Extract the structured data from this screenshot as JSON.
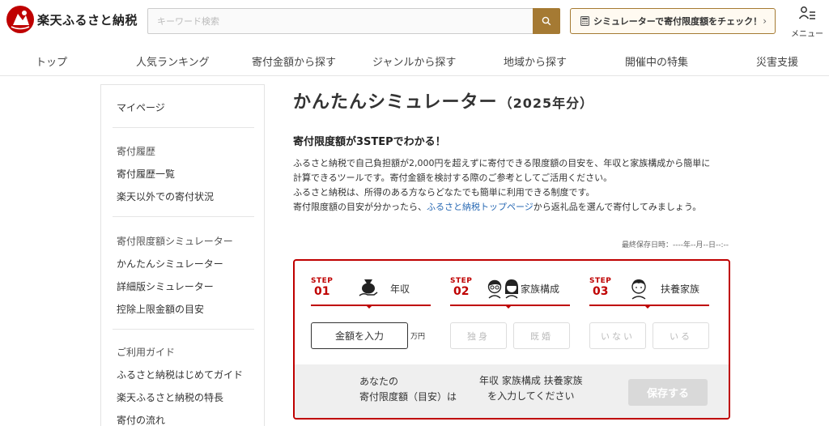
{
  "header": {
    "logo_text": "楽天ふるさと納税",
    "search_placeholder": "キーワード検索",
    "simulator_button_label": "シミュレーターで寄付限度額をチェック！",
    "menu_label": "メニュー"
  },
  "nav": {
    "items": [
      "トップ",
      "人気ランキング",
      "寄付金額から探す",
      "ジャンルから探す",
      "地域から探す",
      "開催中の特集",
      "災害支援"
    ]
  },
  "sidebar": {
    "mypage": "マイページ",
    "history_heading": "寄付履歴",
    "history_list": "寄付履歴一覧",
    "history_other": "楽天以外での寄付状況",
    "simulator_heading": "寄付限度額シミュレーター",
    "simulator_easy": "かんたんシミュレーター",
    "simulator_detail": "詳細版シミュレーター",
    "deduction_limit": "控除上限金額の目安",
    "guide_heading": "ご利用ガイド",
    "guide_first": "ふるさと納税はじめてガイド",
    "guide_features": "楽天ふるさと納税の特長",
    "guide_flow": "寄付の流れ"
  },
  "main": {
    "title": "かんたんシミュレーター",
    "title_year": "（2025年分）",
    "subheading": "寄付限度額が3STEPでわかる！",
    "para1": "ふるさと納税で自己負担額が2,000円を超えずに寄付できる限度額の目安を、年収と家族構成から簡単に",
    "para2": "計算できるツールです。寄付金額を検討する際のご参考としてご活用ください。",
    "para3": "ふるさと納税は、所得のある方ならどなたでも簡単に利用できる制度です。",
    "para4_pre": "寄付限度額の目安が分かったら、",
    "para4_link": "ふるさと納税トップページ",
    "para4_post": "から返礼品を選んで寄付してみましょう。",
    "last_saved": "最終保存日時：----年--月--日--:--"
  },
  "simulator": {
    "step_word": "STEP",
    "steps": [
      {
        "num": "01",
        "title": "年収"
      },
      {
        "num": "02",
        "title": "家族構成"
      },
      {
        "num": "03",
        "title": "扶養家族"
      }
    ],
    "amount_button": "金額を入力",
    "unit": "万円",
    "family_single": "独身",
    "family_married": "既婚",
    "dependents_none": "いない",
    "dependents_yes": "いる",
    "result_label_line1": "あなたの",
    "result_label_line2": "寄付限度額（目安）は",
    "result_message_line1": "年収 家族構成 扶養家族",
    "result_message_line2": "を入力してください",
    "save_button": "保存する"
  },
  "colors": {
    "brand_red": "#bf0000",
    "gold": "#a57a33",
    "link_blue": "#2b6bb5"
  }
}
